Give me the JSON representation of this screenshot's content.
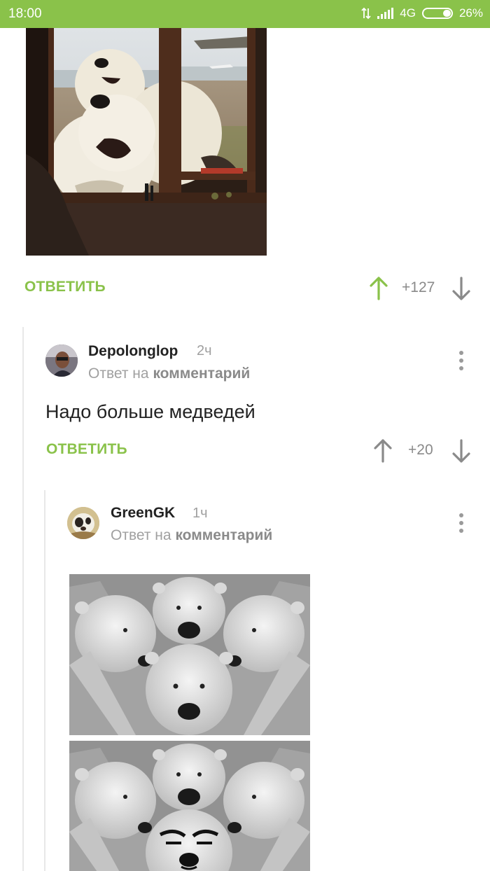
{
  "status": {
    "time": "18:00",
    "network": "4G",
    "battery": "26%"
  },
  "post": {
    "image_icon": "polar-bears-window-photo",
    "reply_label": "ОТВЕТИТЬ",
    "score": "+127"
  },
  "comments": [
    {
      "username": "Depolonglop",
      "ago": "2ч",
      "reply_prefix": "Ответ на",
      "reply_link": "комментарий",
      "text": "Надо больше медведей",
      "reply_label": "ОТВЕТИТЬ",
      "score": "+20"
    },
    {
      "username": "GreenGK",
      "ago": "1ч",
      "reply_prefix": "Ответ на",
      "reply_link": "комментарий",
      "images": [
        "polar-bear-collage",
        "polar-bear-collage-meme-face"
      ]
    }
  ],
  "colors": {
    "accent": "#8ac24a",
    "muted": "#a0a0a0",
    "text": "#222222"
  }
}
